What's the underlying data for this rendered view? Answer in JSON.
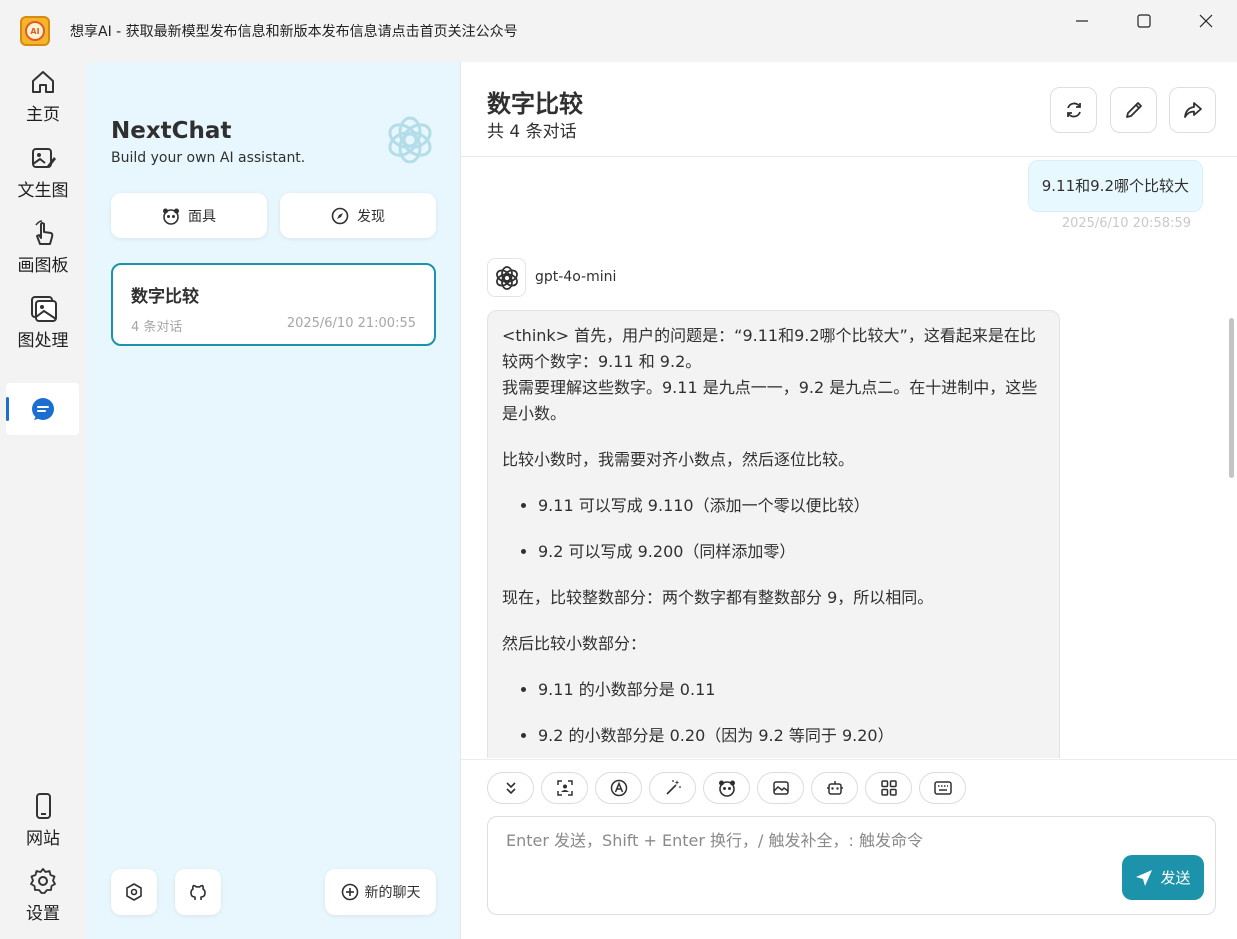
{
  "window": {
    "title": "想享AI  -  获取最新模型发布信息和新版本发布信息请点击首页关注公众号",
    "logo_text": "AI"
  },
  "rail": {
    "items": [
      {
        "label": "主页",
        "icon": "home-icon"
      },
      {
        "label": "文生图",
        "icon": "image-edit-icon"
      },
      {
        "label": "画图板",
        "icon": "hand-pointer-icon"
      },
      {
        "label": "图处理",
        "icon": "photo-icon"
      },
      {
        "label": "",
        "icon": "chat-icon"
      },
      {
        "label": "网站",
        "icon": "phone-icon"
      },
      {
        "label": "设置",
        "icon": "gear-icon"
      }
    ]
  },
  "sidebar": {
    "brand": "NextChat",
    "subtitle": "Build your own AI assistant.",
    "mask_button": "面具",
    "discover_button": "发现",
    "chats": [
      {
        "title": "数字比较",
        "count": "4 条对话",
        "date": "2025/6/10 21:00:55"
      }
    ],
    "new_chat_button": "新的聊天"
  },
  "main": {
    "title": "数字比较",
    "subtitle": "共 4 条对话",
    "messages": {
      "user_text": "9.11和9.2哪个比较大",
      "user_time": "2025/6/10 20:58:59",
      "bot_model": "gpt-4o-mini",
      "bot_p1": "<think> 首先，用户的问题是：“9.11和9.2哪个比较大”，这看起来是在比较两个数字：9.11 和 9.2。",
      "bot_p1b": "我需要理解这些数字。9.11 是九点一一，9.2 是九点二。在十进制中，这些是小数。",
      "bot_p2": "比较小数时，我需要对齐小数点，然后逐位比较。",
      "bot_li1": "9.11 可以写成 9.110（添加一个零以便比较）",
      "bot_li2": "9.2 可以写成 9.200（同样添加零）",
      "bot_p3": "现在，比较整数部分：两个数字都有整数部分 9，所以相同。",
      "bot_p4": "然后比较小数部分：",
      "bot_li3": "9.11 的小数部分是 0.11",
      "bot_li4": "9.2 的小数部分是 0.20（因为 9.2 等同于 9.20）"
    },
    "input_placeholder": "Enter 发送，Shift + Enter 换行，/ 触发补全，: 触发命令",
    "send_label": "发送"
  },
  "colors": {
    "accent": "#1d93ab",
    "sidebar_bg": "#e7f7fd",
    "user_bubble": "#e7f8ff"
  }
}
